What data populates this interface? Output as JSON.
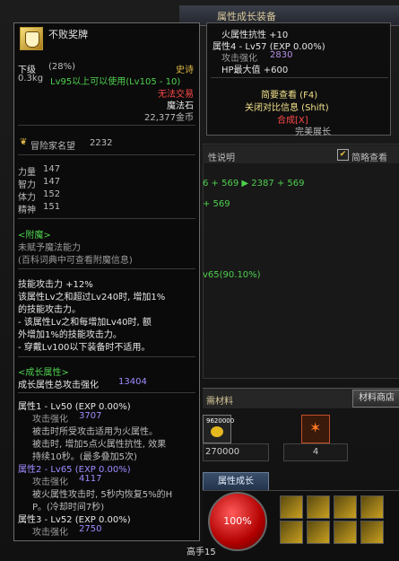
{
  "background": {
    "window_title": "属性成长装备",
    "panel_title": "性说明",
    "checkbox_label": "简略查看",
    "stat_line1": "6 + 569 ▶ 2387 + 569",
    "stat_line2": "+ 569",
    "stat_line3": "v65(90.10%)",
    "material_label": "需材料",
    "shop_button": "材料商店",
    "slot1_count": "9620000",
    "slot1_value": "270000",
    "slot2_value": "4",
    "growth_tab": "属性成长",
    "hp_label": "100%",
    "char_label": "高手15"
  },
  "popup": {
    "line1": "火属性抗性 +10",
    "line2": "属性4 - Lv57 (EXP 0.00%)",
    "line3_label": "攻击强化",
    "line3_value": "2830",
    "line4": "HP最大值 +600",
    "btn1": "简要查看 (F4)",
    "btn2": "关闭对比信息 (Shift)",
    "btn3": "合成[X]",
    "extra": "完美展长"
  },
  "item": {
    "name": "不败奖牌",
    "grade_left": "下级",
    "grade_pct": "(28%)",
    "rarity": "史诗",
    "weight": "0.3kg",
    "level_req": "Lv95以上可以使用(Lv105 - 10)",
    "trade": "无法交易",
    "type": "魔法石",
    "price": "22,377金币",
    "fame_label": "冒险家名望",
    "fame_value": "2232",
    "stats": [
      {
        "name": "力量",
        "value": "147"
      },
      {
        "name": "智力",
        "value": "147"
      },
      {
        "name": "体力",
        "value": "152"
      },
      {
        "name": "精神",
        "value": "151"
      }
    ],
    "enchant_title": "<附魔>",
    "enchant_line1": "未赋予魔法能力",
    "enchant_line2": "(百科词典中可查看附魔信息)",
    "skill_desc": [
      "技能攻击力 +12%",
      "该属性Lv之和超过Lv240时, 增加1%",
      "的技能攻击力。",
      "- 该属性Lv之和每增加Lv40时, 额",
      "外增加1%的技能攻击力。",
      "- 穿戴Lv100以下装备时不适用。"
    ],
    "growth_title": "<成长属性>",
    "growth_total_label": "成长属性总攻击强化",
    "growth_total_value": "13404",
    "attr1_head": "属性1 - Lv50 (EXP 0.00%)",
    "attr1_atk_label": "攻击强化",
    "attr1_atk_value": "3707",
    "attr1_desc": [
      "被击时所受攻击适用为火属性。",
      "被击时, 增加5点火属性抗性, 效果",
      "持续10秒。(最多叠加5次)"
    ],
    "attr2_head": "属性2 - Lv65 (EXP 0.00%)",
    "attr2_atk_label": "攻击强化",
    "attr2_atk_value": "4117",
    "attr2_desc": [
      "被火属性攻击时, 5秒内恢复5%的H",
      "P。(冷却时间7秒)"
    ],
    "attr3_head": "属性3 - Lv52 (EXP 0.00%)",
    "attr3_atk_label": "攻击强化",
    "attr3_atk_value": "2750"
  }
}
